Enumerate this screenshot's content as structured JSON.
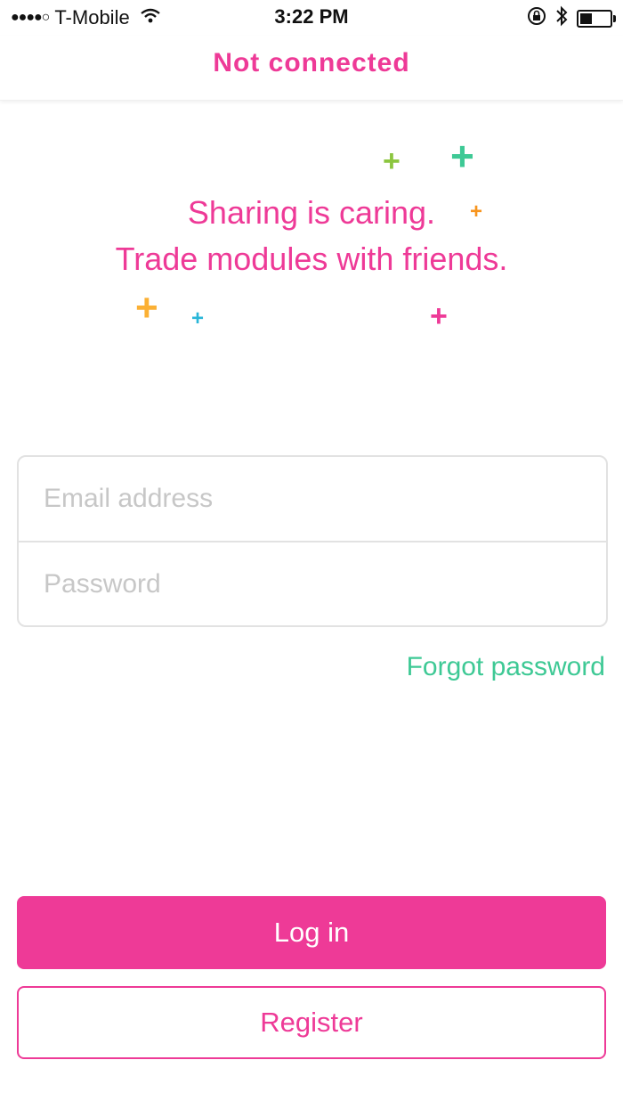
{
  "status_bar": {
    "signal": "●●●●○",
    "carrier": "T-Mobile",
    "time": "3:22 PM",
    "battery_level": 0.4
  },
  "nav": {
    "title": "Not connected"
  },
  "hero": {
    "line1": "Sharing is caring.",
    "line2": "Trade modules with friends."
  },
  "colors": {
    "brand_pink": "#ee3a97",
    "accent_green": "#3ec995"
  },
  "form": {
    "email_placeholder": "Email address",
    "email_value": "",
    "password_placeholder": "Password",
    "password_value": ""
  },
  "links": {
    "forgot_password": "Forgot password"
  },
  "buttons": {
    "login": "Log in",
    "register": "Register"
  }
}
